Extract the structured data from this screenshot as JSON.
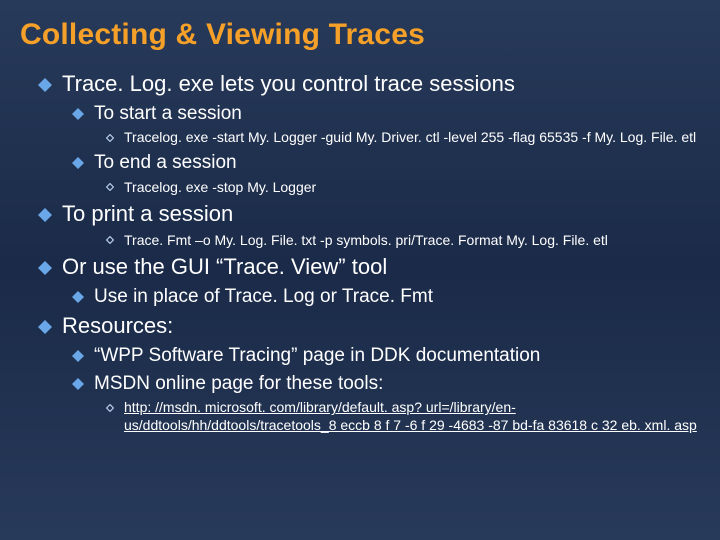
{
  "title": "Collecting & Viewing Traces",
  "items": {
    "tracelog_intro": "Trace. Log. exe lets you control trace sessions",
    "start_session": "To start a session",
    "start_cmd": "Tracelog. exe -start My. Logger -guid My. Driver. ctl -level 255 -flag 65535 -f My. Log. File. etl",
    "end_session": "To end a session",
    "end_cmd": "Tracelog. exe -stop My. Logger",
    "print_session": "To print a session",
    "print_cmd": "Trace. Fmt –o My. Log. File. txt -p symbols. pri/Trace. Format My. Log. File. etl",
    "gui_tool": "Or use the GUI “Trace. View” tool",
    "gui_sub": "Use in place of Trace. Log or Trace. Fmt",
    "resources": "Resources:",
    "wpp": "“WPP Software Tracing” page in DDK documentation",
    "msdn_label": "MSDN online page for these tools:",
    "msdn_url": "http: //msdn. microsoft. com/library/default. asp? url=/library/en-us/ddtools/hh/ddtools/tracetools_8 eccb 8 f 7 -6 f 29 -4683 -87 bd-fa 83618 c 32 eb. xml. asp"
  }
}
